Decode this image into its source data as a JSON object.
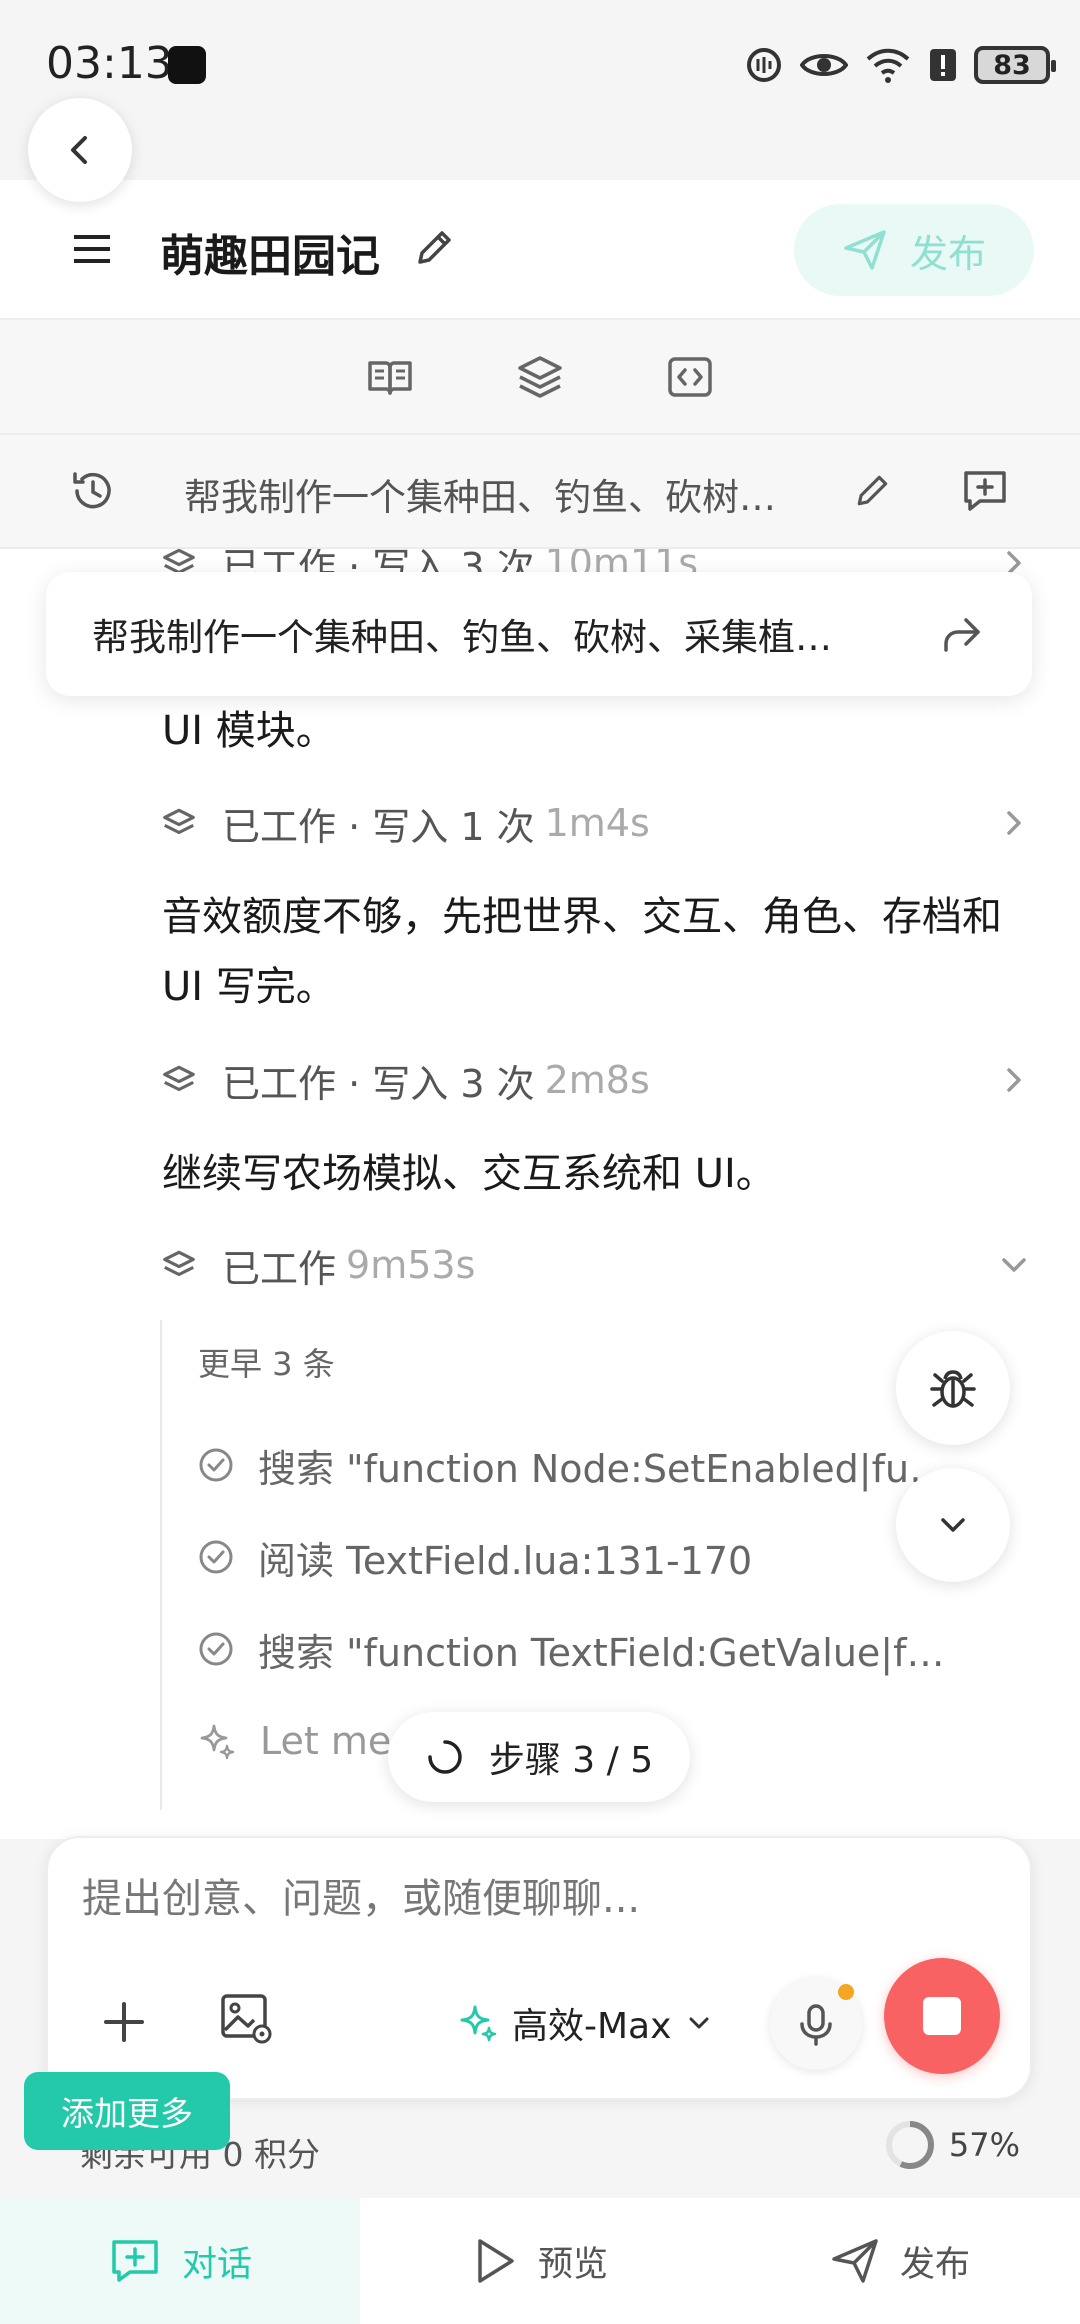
{
  "status_bar": {
    "time": "03:13",
    "battery": "83"
  },
  "header": {
    "title": "萌趣田园记",
    "publish_label": "发布"
  },
  "prompt_bar": {
    "text": "帮我制作一个集种田、钓鱼、砍树…"
  },
  "floating_prompt": {
    "text": "帮我制作一个集种田、钓鱼、砍树、采集植…"
  },
  "chat": {
    "partial_row": {
      "label": "已工作 · 写入 3 次",
      "duration": "10m11s"
    },
    "messages": [
      "UI 模块。",
      "音效额度不够，先把世界、交互、角色、存档和 UI 写完。",
      "继续写农场模拟、交互系统和 UI。"
    ],
    "work_rows": [
      {
        "label": "已工作 · 写入 1 次",
        "duration": "1m4s"
      },
      {
        "label": "已工作 · 写入 3 次",
        "duration": "2m8s"
      },
      {
        "label": "已工作",
        "duration": "9m53s"
      }
    ],
    "earlier_label": "更早 3 条",
    "steps": [
      "搜索 \"function Node:SetEnabled|fu…",
      "阅读 TextField.lua:131-170",
      "搜索 \"function TextField:GetValue|fu…",
      "Let me                         the UI mod…"
    ],
    "step_progress": "步骤 3 / 5"
  },
  "input": {
    "placeholder": "提出创意、问题，或随便聊聊...",
    "model": "高效-Max"
  },
  "footer": {
    "credits": "剩余可用 0 积分",
    "add_more": "添加更多",
    "progress_value": 0.57,
    "progress_label": "57%"
  },
  "nav": {
    "chat": "对话",
    "preview": "预览",
    "publish": "发布"
  },
  "colors": {
    "accent": "#23c9a9",
    "stop": "#f86263"
  }
}
